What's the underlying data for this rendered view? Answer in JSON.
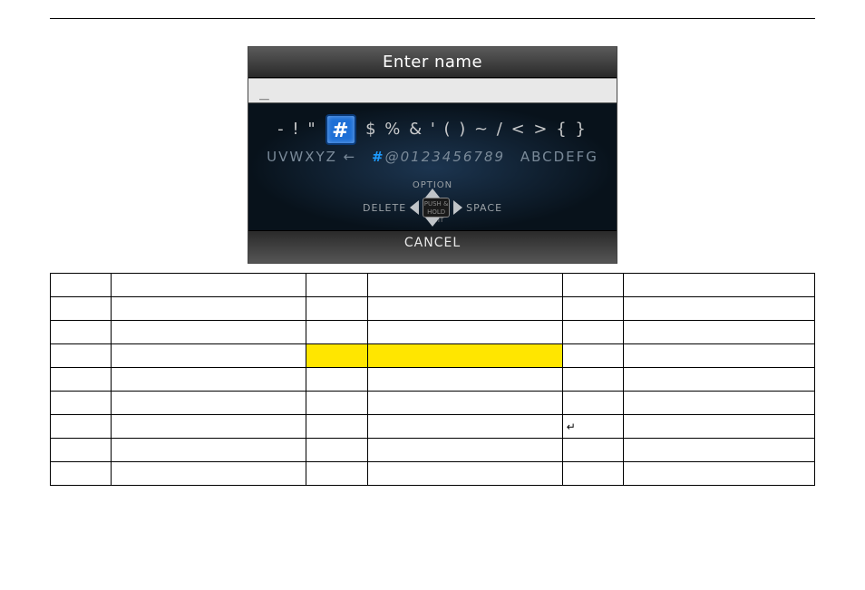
{
  "device": {
    "title": "Enter name",
    "input_value": "_",
    "symbol_row_before": "- ! \"",
    "symbol_highlight": "#",
    "symbol_row_after": "$ % & ' ( ) ~ / < > { }",
    "arc_left": "UVWXYZ ←",
    "arc_numbers_hash": "#",
    "arc_numbers_rest": "@0123456789",
    "arc_right": "ABCDEFG",
    "dpad": {
      "option": "OPTION",
      "delete": "DELETE",
      "space": "SPACE",
      "center_top": "PUSH & HOLD",
      "center_bottom": "EDIT"
    },
    "cancel": "CANCEL"
  },
  "table": {
    "headers": [
      "",
      "",
      "",
      "",
      "",
      ""
    ],
    "rows": [
      [
        "",
        "",
        "",
        "",
        "",
        ""
      ],
      [
        "",
        "",
        "",
        "",
        "",
        ""
      ],
      [
        "",
        "",
        "",
        "",
        "",
        ""
      ],
      [
        "",
        "",
        "",
        "",
        "",
        ""
      ],
      [
        "",
        "",
        "",
        "",
        "",
        ""
      ],
      [
        "",
        "",
        "",
        "",
        "↵",
        ""
      ],
      [
        "",
        "",
        "",
        "",
        "",
        ""
      ],
      [
        "",
        "",
        "",
        "",
        "",
        ""
      ]
    ],
    "highlight_row_index": 2,
    "highlight_col_start": 2,
    "highlight_col_end": 3
  }
}
